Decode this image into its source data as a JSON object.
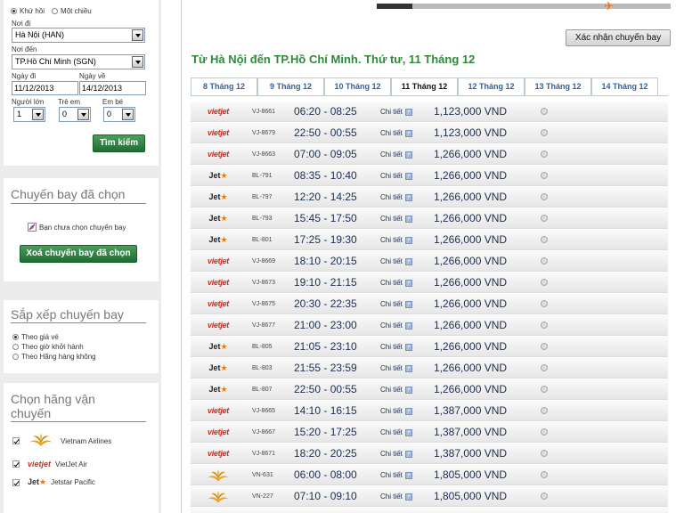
{
  "search": {
    "trip_roundtrip": "Khứ hồi",
    "trip_oneway": "Một chiều",
    "from_label": "Nơi đi",
    "from_value": "Hà Nội (HAN)",
    "to_label": "Nơi đến",
    "to_value": "TP.Hồ Chí Minh (SGN)",
    "depart_label": "Ngày đi",
    "depart_value": "11/12/2013",
    "return_label": "Ngày về",
    "return_value": "14/12/2013",
    "adult_label": "Người lớn",
    "adult_value": "1",
    "child_label": "Trẻ em",
    "child_value": "0",
    "infant_label": "Em bé",
    "infant_value": "0",
    "search_button": "Tìm kiếm"
  },
  "selected_panel": {
    "title": "Chuyến bay đã chọn",
    "empty_text": "Bạn chưa chọn chuyến bay",
    "clear_button": "Xoá chuyến bay đã chọn"
  },
  "sort_panel": {
    "title": "Sắp xếp chuyến bay",
    "options": [
      "Theo giá vé",
      "Theo giờ khởi hành",
      "Theo Hãng hàng không"
    ]
  },
  "airline_panel": {
    "title_line1": "Chọn hãng vận",
    "title_line2": "chuyến",
    "airlines": [
      {
        "name": "Vietnam Airlines",
        "logo": "vn"
      },
      {
        "name": "VietJet Air",
        "logo": "vj"
      },
      {
        "name": "Jetstar Pacific",
        "logo": "bl"
      }
    ]
  },
  "logos": {
    "vietjet": "vietjet",
    "jet": "Jet",
    "star": "★"
  },
  "main": {
    "confirm_button": "Xác nhận chuyến bay",
    "route_title": "Từ Hà Nội đến TP.Hồ Chí Minh. Thứ tư, 11 Tháng 12",
    "detail_label": "Chi tiết",
    "plane_icon": "✈",
    "progress": 0.12,
    "tabs": [
      "8 Tháng 12",
      "9 Tháng 12",
      "10 Tháng 12",
      "11 Tháng 12",
      "12 Tháng 12",
      "13 Tháng 12",
      "14 Tháng 12"
    ],
    "active_tab": 3,
    "flights": [
      {
        "logo": "vj",
        "no": "VJ-8661",
        "time": "06:20 - 08:25",
        "price": "1,123,000 VND"
      },
      {
        "logo": "vj",
        "no": "VJ-8679",
        "time": "22:50 - 00:55",
        "price": "1,123,000 VND"
      },
      {
        "logo": "vj",
        "no": "VJ-8663",
        "time": "07:00 - 09:05",
        "price": "1,266,000 VND"
      },
      {
        "logo": "bl",
        "no": "BL-791",
        "time": "08:35 - 10:40",
        "price": "1,266,000 VND"
      },
      {
        "logo": "bl",
        "no": "BL-797",
        "time": "12:20 - 14:25",
        "price": "1,266,000 VND"
      },
      {
        "logo": "bl",
        "no": "BL-793",
        "time": "15:45 - 17:50",
        "price": "1,266,000 VND"
      },
      {
        "logo": "bl",
        "no": "BL-801",
        "time": "17:25 - 19:30",
        "price": "1,266,000 VND"
      },
      {
        "logo": "vj",
        "no": "VJ-8669",
        "time": "18:10 - 20:15",
        "price": "1,266,000 VND"
      },
      {
        "logo": "vj",
        "no": "VJ-8673",
        "time": "19:10 - 21:15",
        "price": "1,266,000 VND"
      },
      {
        "logo": "vj",
        "no": "VJ-8675",
        "time": "20:30 - 22:35",
        "price": "1,266,000 VND"
      },
      {
        "logo": "vj",
        "no": "VJ-8677",
        "time": "21:00 - 23:00",
        "price": "1,266,000 VND"
      },
      {
        "logo": "bl",
        "no": "BL-805",
        "time": "21:05 - 23:10",
        "price": "1,266,000 VND"
      },
      {
        "logo": "bl",
        "no": "BL-803",
        "time": "21:55 - 23:59",
        "price": "1,266,000 VND"
      },
      {
        "logo": "bl",
        "no": "BL-807",
        "time": "22:50 - 00:55",
        "price": "1,266,000 VND"
      },
      {
        "logo": "vj",
        "no": "VJ-8665",
        "time": "14:10 - 16:15",
        "price": "1,387,000 VND"
      },
      {
        "logo": "vj",
        "no": "VJ-8667",
        "time": "15:20 - 17:25",
        "price": "1,387,000 VND"
      },
      {
        "logo": "vj",
        "no": "VJ-8671",
        "time": "18:20 - 20:25",
        "price": "1,387,000 VND"
      },
      {
        "logo": "vn",
        "no": "VN-631",
        "time": "06:00 - 08:00",
        "price": "1,805,000 VND"
      },
      {
        "logo": "vn",
        "no": "VN-227",
        "time": "07:10 - 09:10",
        "price": "1,805,000 VND"
      },
      {
        "logo": "vn",
        "no": "",
        "time": "",
        "price": ""
      }
    ]
  }
}
